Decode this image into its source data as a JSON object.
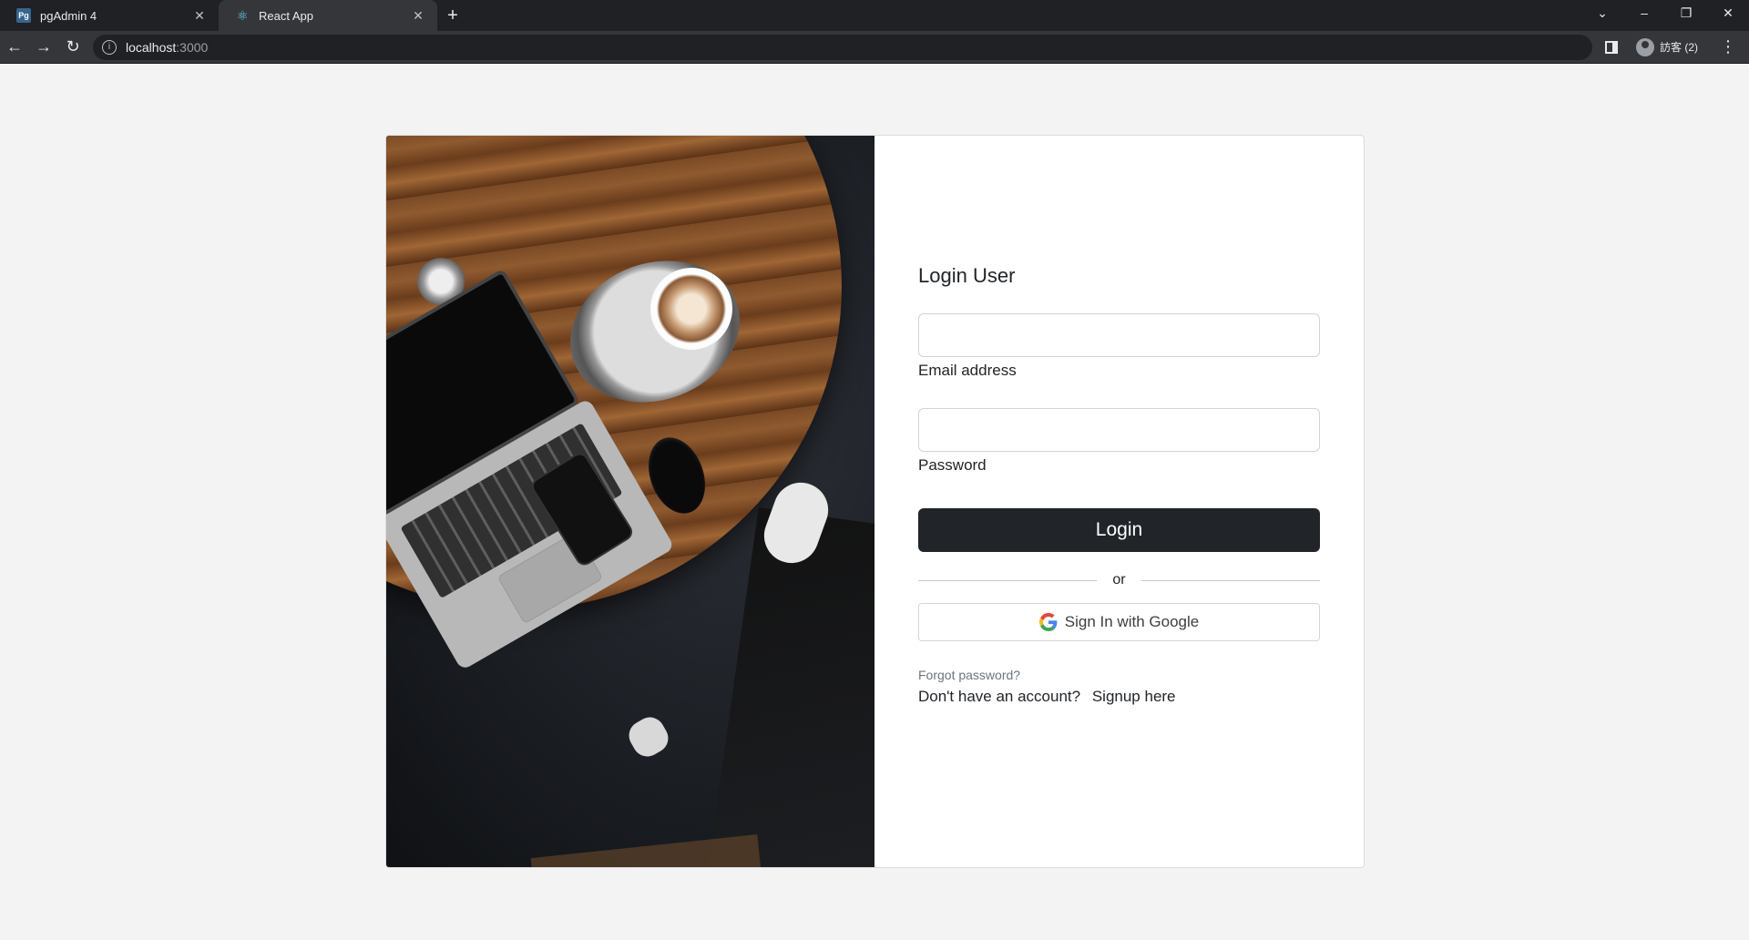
{
  "browser": {
    "tabs": [
      {
        "title": "pgAdmin 4",
        "favicon": "postgres-elephant-icon",
        "active": false
      },
      {
        "title": "React App",
        "favicon": "react-atom-icon",
        "active": true
      }
    ],
    "new_tab_symbol": "+",
    "address": {
      "host": "localhost",
      "port": ":3000"
    },
    "profile_label": "訪客 (2)",
    "window_controls": {
      "collapse": "⌄",
      "minimize": "–",
      "restore": "❐",
      "close": "✕"
    }
  },
  "login": {
    "title": "Login User",
    "email_label": "Email address",
    "email_value": "",
    "password_label": "Password",
    "password_value": "",
    "login_button": "Login",
    "divider_text": "or",
    "google_button": "Sign In with Google",
    "forgot_link": "Forgot password?",
    "no_account_text": "Don't have an account?",
    "signup_link": "Signup here"
  },
  "colors": {
    "primary_button": "#212529",
    "page_bg": "#f3f3f3",
    "browser_dark": "#202124"
  }
}
